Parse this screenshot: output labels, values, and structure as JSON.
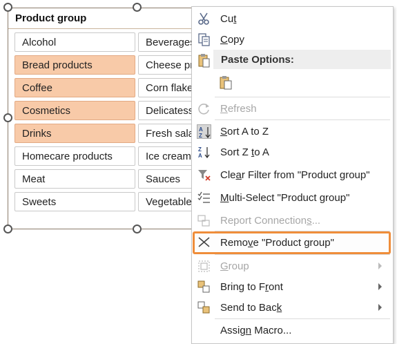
{
  "slicer": {
    "title": "Product group",
    "left_column": [
      {
        "label": "Alcohol",
        "selected": false
      },
      {
        "label": "Bread products",
        "selected": true
      },
      {
        "label": "Coffee",
        "selected": true
      },
      {
        "label": "Cosmetics",
        "selected": true
      },
      {
        "label": "Drinks",
        "selected": true
      },
      {
        "label": "Homecare products",
        "selected": false
      },
      {
        "label": "Meat",
        "selected": false
      },
      {
        "label": "Sweets",
        "selected": false
      }
    ],
    "right_column": [
      {
        "label": "Beverages",
        "selected": false
      },
      {
        "label": "Cheese pr",
        "selected": false
      },
      {
        "label": "Corn flake",
        "selected": false
      },
      {
        "label": "Delicatess",
        "selected": false
      },
      {
        "label": "Fresh sala",
        "selected": false
      },
      {
        "label": "Ice cream",
        "selected": false
      },
      {
        "label": "Sauces",
        "selected": false
      },
      {
        "label": "Vegetable",
        "selected": false
      }
    ]
  },
  "context_menu": {
    "cut": {
      "pre": "Cu",
      "key": "t",
      "post": ""
    },
    "copy": {
      "pre": "",
      "key": "C",
      "post": "opy"
    },
    "paste_options": "Paste Options:",
    "refresh": {
      "pre": "",
      "key": "R",
      "post": "efresh"
    },
    "sort_az": {
      "pre": "",
      "key": "S",
      "post": "ort A to Z"
    },
    "sort_za": {
      "pre": "Sort Z ",
      "key": "t",
      "post": "o A"
    },
    "clear_filter": {
      "pre": "Cle",
      "key": "a",
      "post": "r Filter from \"Product group\""
    },
    "multi_select": {
      "pre": "",
      "key": "M",
      "post": "ulti-Select \"Product group\""
    },
    "report_connections": {
      "pre": "Report Connection",
      "key": "s",
      "post": "..."
    },
    "remove": {
      "pre": "Remo",
      "key": "v",
      "post": "e \"Product group\""
    },
    "group": {
      "pre": "",
      "key": "G",
      "post": "roup"
    },
    "bring_to_front": {
      "pre": "Bring to F",
      "key": "r",
      "post": "ont"
    },
    "send_to_back": {
      "pre": "Send to Bac",
      "key": "k",
      "post": ""
    },
    "assign_macro": {
      "pre": "Assig",
      "key": "n",
      "post": " Macro..."
    }
  },
  "colors": {
    "selected_item": "#f8caa8",
    "highlight_border": "#ef8d3a",
    "disabled_text": "#a6a6a6"
  }
}
